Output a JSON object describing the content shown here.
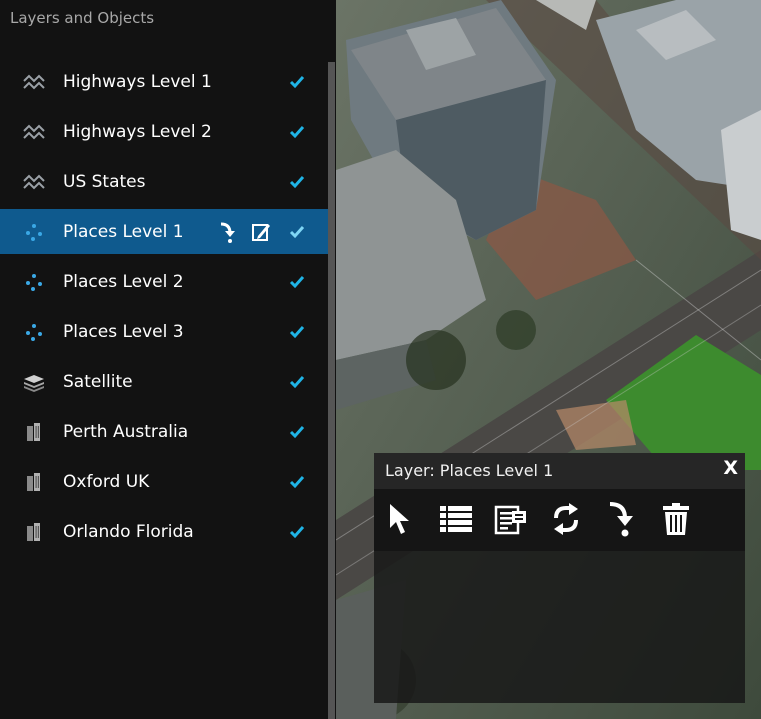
{
  "panel": {
    "title": "Layers and Objects",
    "layers": [
      {
        "label": "Highways Level 1",
        "icon": "polyline-layer-icon",
        "visible": true
      },
      {
        "label": "Highways Level 2",
        "icon": "polyline-layer-icon",
        "visible": true
      },
      {
        "label": "US States",
        "icon": "polyline-layer-icon",
        "visible": true
      },
      {
        "label": "Places Level 1",
        "icon": "point-layer-icon",
        "visible": true,
        "selected": true
      },
      {
        "label": "Places Level 2",
        "icon": "point-layer-icon",
        "visible": true
      },
      {
        "label": "Places Level 3",
        "icon": "point-layer-icon",
        "visible": true
      },
      {
        "label": "Satellite",
        "icon": "imagery-layer-icon",
        "visible": true
      },
      {
        "label": "Perth Australia",
        "icon": "buildings-layer-icon",
        "visible": true
      },
      {
        "label": "Oxford UK",
        "icon": "buildings-layer-icon",
        "visible": true
      },
      {
        "label": "Orlando Florida",
        "icon": "buildings-layer-icon",
        "visible": true
      }
    ]
  },
  "popup": {
    "title": "Layer: Places Level 1",
    "close_label": "X",
    "tools": [
      "select-tool",
      "attribute-table",
      "properties",
      "refresh",
      "fly-to",
      "delete"
    ]
  },
  "colors": {
    "accent": "#1fb4e6",
    "selected_row": "#0f5a8e",
    "panel_bg": "#121212"
  }
}
